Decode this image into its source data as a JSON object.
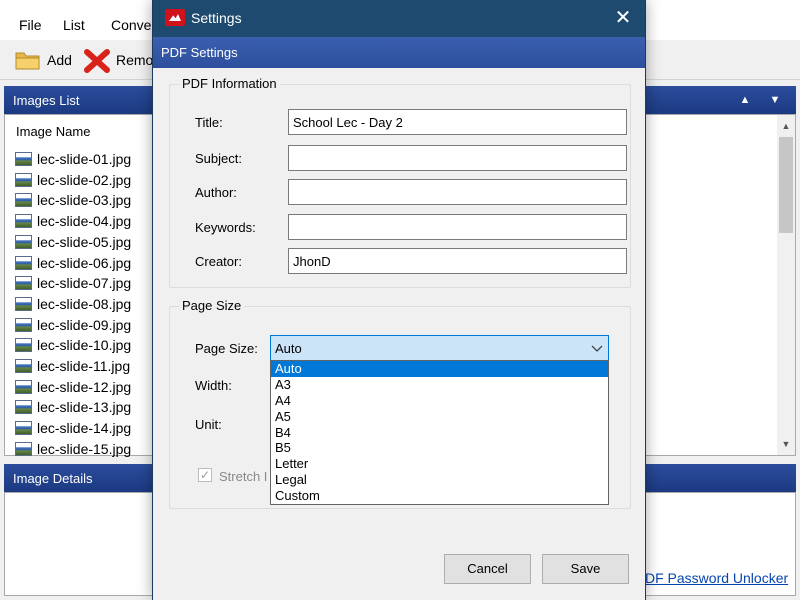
{
  "app": {
    "menu": [
      "File",
      "List",
      "Conve"
    ],
    "toolbar": {
      "add_label": "Add",
      "remove_label": "Remo"
    },
    "images_panel": {
      "title": "Images List",
      "column_header": "Image Name",
      "files": [
        "lec-slide-01.jpg",
        "lec-slide-02.jpg",
        "lec-slide-03.jpg",
        "lec-slide-04.jpg",
        "lec-slide-05.jpg",
        "lec-slide-06.jpg",
        "lec-slide-07.jpg",
        "lec-slide-08.jpg",
        "lec-slide-09.jpg",
        "lec-slide-10.jpg",
        "lec-slide-11.jpg",
        "lec-slide-12.jpg",
        "lec-slide-13.jpg",
        "lec-slide-14.jpg",
        "lec-slide-15.jpg"
      ]
    },
    "details_panel": {
      "title": "Image Details"
    },
    "link_text": "DF Password Unlocker"
  },
  "dialog": {
    "title": "Settings",
    "header": "PDF Settings",
    "info_group": {
      "title": "PDF Information",
      "fields": [
        {
          "label": "Title:",
          "value": "School Lec - Day 2"
        },
        {
          "label": "Subject:",
          "value": ""
        },
        {
          "label": "Author:",
          "value": ""
        },
        {
          "label": "Keywords:",
          "value": ""
        },
        {
          "label": "Creator:",
          "value": "JhonD"
        }
      ]
    },
    "size_group": {
      "title": "Page Size",
      "page_size_label": "Page Size:",
      "page_size_value": "Auto",
      "width_label": "Width:",
      "unit_label": "Unit:",
      "stretch_label": "Stretch I",
      "stretch_checked": true,
      "options": [
        "Auto",
        "A3",
        "A4",
        "A5",
        "B4",
        "B5",
        "Letter",
        "Legal",
        "Custom"
      ],
      "selected_option": "Auto"
    },
    "buttons": {
      "cancel": "Cancel",
      "save": "Save"
    }
  },
  "colors": {
    "dialog_title_bar": "#1d4a6e",
    "panel_header": "#2b4d9c",
    "selection": "#0078d7",
    "select_highlight": "#cce4f7",
    "link": "#0645ad"
  },
  "icons": [
    "folder-icon",
    "remove-x-icon",
    "image-file-icon",
    "app-logo-icon",
    "close-icon",
    "chevron-down-icon",
    "checkbox-checked-icon",
    "arrow-up-icon",
    "arrow-down-icon"
  ]
}
